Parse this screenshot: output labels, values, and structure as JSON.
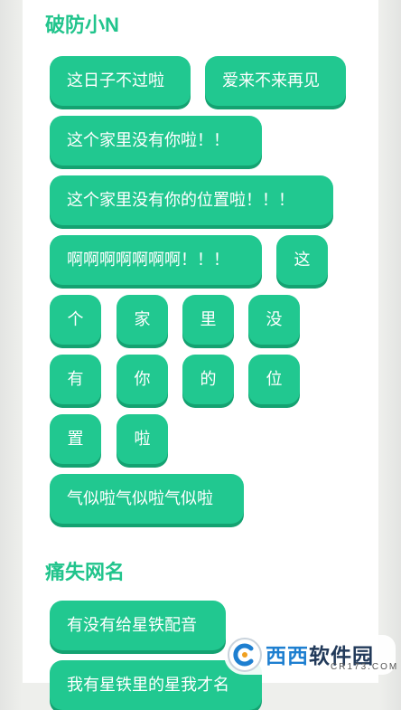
{
  "sections": [
    {
      "title": "破防小N",
      "chips": [
        "这日子不过啦",
        "爱来不来再见",
        "这个家里没有你啦！！",
        "这个家里没有你的位置啦！！！",
        "啊啊啊啊啊啊啊！！！",
        "这",
        "个",
        "家",
        "里",
        "没",
        "有",
        "你",
        "的",
        "位",
        "置",
        "啦",
        "气似啦气似啦气似啦"
      ]
    },
    {
      "title": "痛失网名",
      "chips": [
        "有没有给星铁配音",
        "我有星铁里的星我才名"
      ]
    }
  ],
  "watermark": {
    "brand_a": "西西",
    "brand_b": "软件园",
    "domain": "CR173.COM"
  },
  "colors": {
    "accent": "#21c890",
    "title": "#21c48c"
  }
}
